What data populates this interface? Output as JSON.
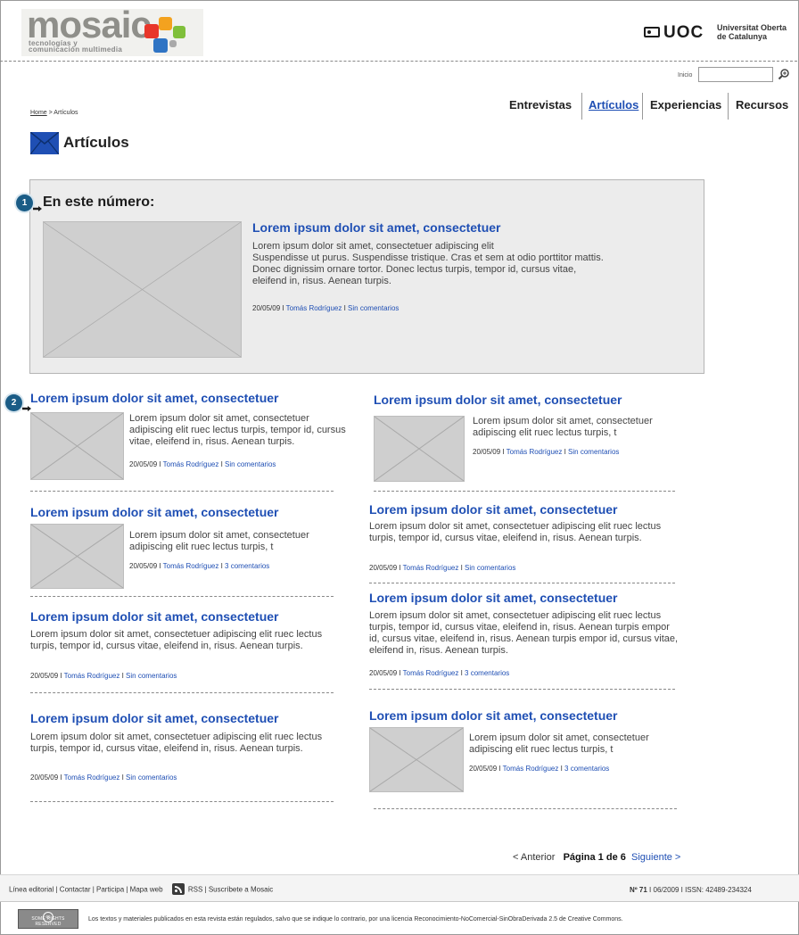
{
  "header": {
    "logo_word": "mosaic",
    "logo_sub_1": "tecnologías y",
    "logo_sub_2": "comunicación multimedia",
    "uoc_text": "UOC",
    "university_line1": "Universitat Oberta",
    "university_line2": "de Catalunya",
    "search_label": "Inicio",
    "search_value": "",
    "colors": {
      "brand_blue": "#1f4fb4",
      "logo_red": "#e8362a",
      "logo_orange": "#f3a21f",
      "logo_green": "#7fbf3a",
      "logo_blue": "#2f74c4"
    }
  },
  "nav": {
    "items": [
      {
        "label": "Entrevistas",
        "active": false
      },
      {
        "label": "Artículos",
        "active": true
      },
      {
        "label": "Experiencias",
        "active": false
      },
      {
        "label": "Recursos",
        "active": false
      }
    ]
  },
  "breadcrumb": {
    "home": "Home",
    "separator": " > ",
    "current": "Artículos"
  },
  "page": {
    "title": "Artículos"
  },
  "featured": {
    "badge": "1",
    "heading": "En este número:",
    "title": "Lorem ipsum dolor sit amet, consectetuer",
    "excerpt_1": "Lorem ipsum dolor sit amet, consectetuer adipiscing elit",
    "excerpt_2": "Suspendisse ut purus. Suspendisse tristique. Cras et sem at odio porttitor mattis.",
    "excerpt_3": "Donec dignissim ornare tortor. Donec lectus turpis, tempor id, cursus vitae,",
    "excerpt_4": "eleifend in, risus. Aenean turpis.",
    "date": "20/05/09",
    "author": "Tomás Rodríguez",
    "comments": "Sin comentarios"
  },
  "list_badge": "2",
  "articles_left": [
    {
      "title": "Lorem ipsum dolor sit amet, consectetuer",
      "excerpt": "Lorem ipsum dolor sit amet, consectetuer adipiscing elit ruec lectus turpis, tempor id, cursus vitae, eleifend in, risus. Aenean turpis.",
      "date": "20/05/09",
      "author": "Tomás Rodríguez",
      "comments": "Sin comentarios"
    },
    {
      "title": "Lorem ipsum dolor sit amet, consectetuer",
      "excerpt": "Lorem ipsum dolor sit amet, consectetuer adipiscing elit ruec lectus turpis, t",
      "date": "20/05/09",
      "author": "Tomás Rodríguez",
      "comments": "3 comentarios"
    },
    {
      "title": "Lorem ipsum dolor sit amet, consectetuer",
      "excerpt": "Lorem ipsum dolor sit amet, consectetuer adipiscing elit ruec lectus turpis, tempor id, cursus vitae, eleifend in, risus. Aenean turpis.",
      "date": "20/05/09",
      "author": "Tomás Rodríguez",
      "comments": "Sin comentarios"
    },
    {
      "title": "Lorem ipsum dolor sit amet, consectetuer",
      "excerpt": "Lorem ipsum dolor sit amet, consectetuer adipiscing elit ruec lectus turpis, tempor id, cursus vitae, eleifend in, risus. Aenean turpis.",
      "date": "20/05/09",
      "author": "Tomás Rodríguez",
      "comments": "Sin comentarios"
    }
  ],
  "articles_right": [
    {
      "title": "Lorem ipsum dolor sit amet, consectetuer",
      "excerpt": "Lorem ipsum dolor sit amet, consectetuer adipiscing elit ruec lectus turpis, t",
      "date": "20/05/09",
      "author": "Tomás Rodríguez",
      "comments": "Sin comentarios"
    },
    {
      "title": "Lorem ipsum dolor sit amet, consectetuer",
      "excerpt": "Lorem ipsum dolor sit amet, consectetuer adipiscing elit ruec lectus turpis, tempor id, cursus vitae, eleifend in, risus. Aenean turpis.",
      "date": "20/05/09",
      "author": "Tomás Rodríguez",
      "comments": "Sin comentarios"
    },
    {
      "title": "Lorem ipsum dolor sit amet, consectetuer",
      "excerpt": "Lorem ipsum dolor sit amet, consectetuer adipiscing elit ruec lectus turpis, tempor id, cursus vitae, eleifend in, risus. Aenean turpis empor id, cursus vitae, eleifend in, risus. Aenean turpis empor id, cursus vitae, eleifend in, risus. Aenean turpis.",
      "date": "20/05/09",
      "author": "Tomás Rodríguez",
      "comments": "3 comentarios"
    },
    {
      "title": "Lorem ipsum dolor sit amet, consectetuer",
      "excerpt": "Lorem ipsum dolor sit amet, consectetuer adipiscing elit ruec lectus turpis, t",
      "date": "20/05/09",
      "author": "Tomás Rodríguez",
      "comments": "3 comentarios"
    }
  ],
  "meta_separator": " I ",
  "pager": {
    "prev": "< Anterior",
    "current": "Página 1 de 6",
    "next": "Siguiente >"
  },
  "footer": {
    "links": [
      "Línea editorial",
      "Contactar",
      "Participa",
      "Mapa web"
    ],
    "rss": "RSS",
    "subscribe": "Suscríbete a Mosaic",
    "issue": "Nº 71",
    "issue_rest": " I 06/2009  I  ISSN: 42489-234324",
    "cc_logo": "cc",
    "cc_text": "SOME RIGHTS RESERVED",
    "license": "Los textos y materiales publicados en esta revista están regulados, salvo que se indique lo contrario, por una licencia Reconocimiento-NoComercial-SinObraDerivada 2.5 de Creative Commons."
  }
}
